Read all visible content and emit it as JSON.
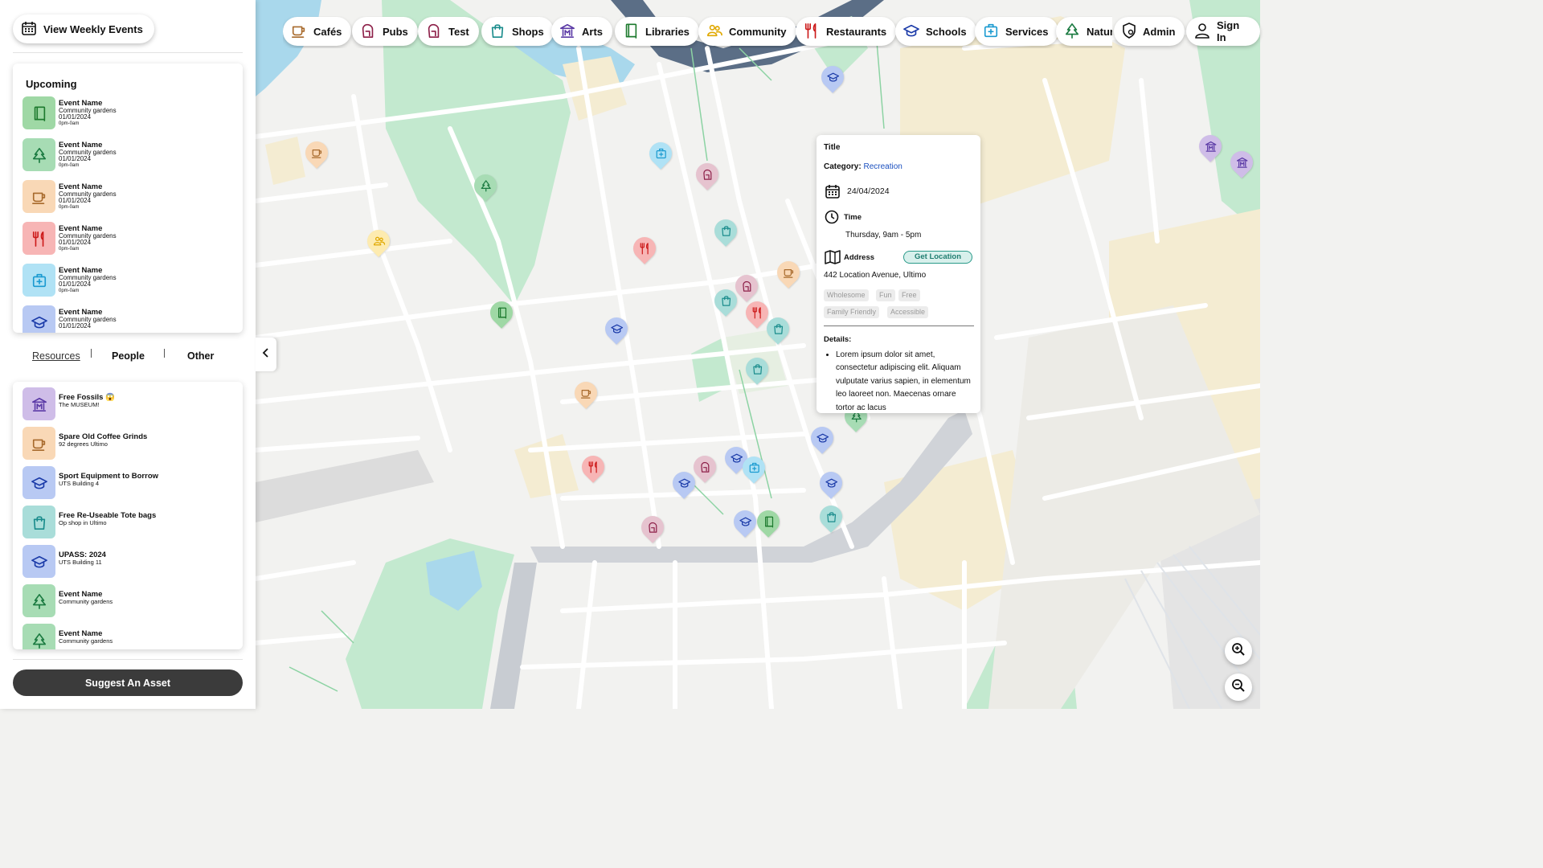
{
  "colors": {
    "cafe": "#f9d8b6",
    "cafe_fg": "#a86a2c",
    "pub": "#e6c3cf",
    "pub_fg": "#8d1f48",
    "shop": "#a9ddd9",
    "shop_fg": "#1a8c8c",
    "art": "#cfbde8",
    "art_fg": "#5b3aa6",
    "library": "#9fd8a5",
    "library_fg": "#1d7a2e",
    "community": "#fdebb0",
    "community_fg": "#e0a800",
    "restaurant": "#f7b5b5",
    "restaurant_fg": "#cc1a1a",
    "school": "#b8c9f3",
    "school_fg": "#1a3aa8",
    "service": "#b0e2f5",
    "service_fg": "#1a9ad0",
    "nature": "#a7dcb4",
    "nature_fg": "#1a7a40",
    "dark": "#3b3b3b",
    "link": "#1a4fbf"
  },
  "sidebar": {
    "view_weekly_events": "View Weekly Events",
    "upcoming_title": "Upcoming",
    "events": [
      {
        "icon": "library",
        "name": "Event Name",
        "location": "Community gardens",
        "date": "01/01/2024",
        "time": "0pm-0am"
      },
      {
        "icon": "nature",
        "name": "Event Name",
        "location": "Community gardens",
        "date": "01/01/2024",
        "time": "0pm-0am"
      },
      {
        "icon": "cafe",
        "name": "Event Name",
        "location": "Community gardens",
        "date": "01/01/2024",
        "time": "0pm-0am"
      },
      {
        "icon": "restaurant",
        "name": "Event Name",
        "location": "Community gardens",
        "date": "01/01/2024",
        "time": "0pm-0am"
      },
      {
        "icon": "service",
        "name": "Event Name",
        "location": "Community gardens",
        "date": "01/01/2024",
        "time": "0pm-0am"
      },
      {
        "icon": "school",
        "name": "Event Name",
        "location": "Community gardens",
        "date": "01/01/2024",
        "time": ""
      }
    ],
    "tabs": [
      "Resources",
      "People",
      "Other"
    ],
    "resources": [
      {
        "icon": "art",
        "name": "Free Fossils 😱",
        "sub": "The MUSEUM!"
      },
      {
        "icon": "cafe",
        "name": "Spare Old Coffee Grinds",
        "sub": "92 degrees Ultimo"
      },
      {
        "icon": "school",
        "name": "Sport Equipment to Borrow",
        "sub": "UTS Building 4"
      },
      {
        "icon": "shop",
        "name": "Free Re-Useable Tote bags",
        "sub": "Op shop in Ultimo"
      },
      {
        "icon": "school",
        "name": "UPASS: 2024",
        "sub": "UTS Building 11"
      },
      {
        "icon": "nature",
        "name": "Event Name",
        "sub": "Community gardens"
      },
      {
        "icon": "nature",
        "name": "Event Name",
        "sub": "Community gardens"
      }
    ],
    "suggest_button": "Suggest An Asset"
  },
  "categories": [
    {
      "icon": "cafe",
      "label": "Cafés"
    },
    {
      "icon": "pub",
      "label": "Pubs"
    },
    {
      "icon": "pub",
      "label": "Test"
    },
    {
      "icon": "shop",
      "label": "Shops"
    },
    {
      "icon": "art",
      "label": "Arts"
    },
    {
      "icon": "library",
      "label": "Libraries"
    },
    {
      "icon": "community",
      "label": "Community"
    },
    {
      "icon": "restaurant",
      "label": "Restaurants"
    },
    {
      "icon": "school",
      "label": "Schools"
    },
    {
      "icon": "service",
      "label": "Services"
    },
    {
      "icon": "nature",
      "label": "Nature"
    }
  ],
  "header": {
    "admin": "Admin",
    "sign_in": "Sign In"
  },
  "popup": {
    "title": "Title",
    "category_label": "Category:",
    "category_value": "Recreation",
    "date": "24/04/2024",
    "time_label": "Time",
    "time_value": "Thursday, 9am - 5pm",
    "address_label": "Address",
    "get_location": "Get Location",
    "address_value": "442 Location Avenue, Ultimo",
    "tags": [
      "Wholesome",
      "Fun",
      "Free",
      "Family Friendly",
      "Accessible"
    ],
    "details_label": "Details:",
    "details_text": "Lorem ipsum dolor sit amet, consectetur adipiscing elit. Aliquam vulputate varius sapien, in elementum leo laoreet non. Maecenas ornare tortor ac lacus"
  },
  "map_markers": [
    "school",
    "cafe",
    "service",
    "pub",
    "nature",
    "community",
    "shop",
    "restaurant",
    "pub",
    "cafe",
    "shop",
    "restaurant",
    "shop",
    "library",
    "school",
    "shop",
    "cafe",
    "restaurant",
    "nature",
    "school",
    "pub",
    "school",
    "service",
    "school",
    "school",
    "shop",
    "pub",
    "school",
    "library",
    "art",
    "art"
  ]
}
